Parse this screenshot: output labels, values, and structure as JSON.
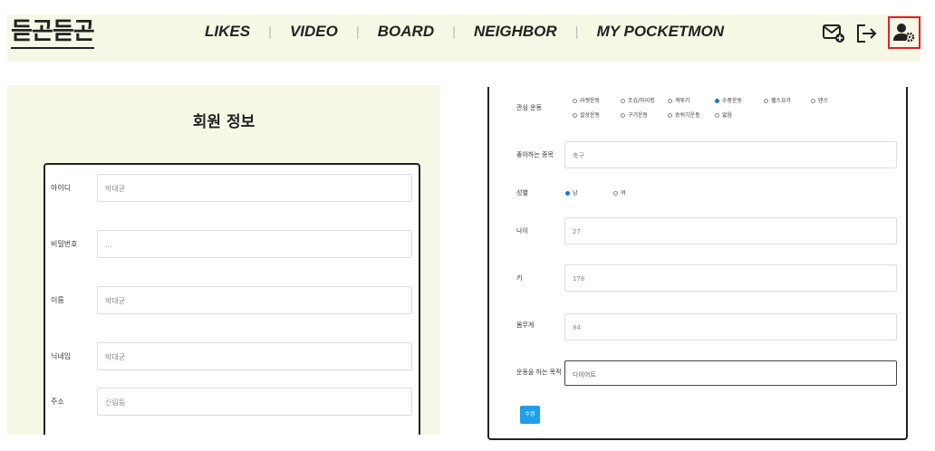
{
  "header": {
    "logo": "듣곤듣곤",
    "menu": [
      "LIKES",
      "VIDEO",
      "BOARD",
      "NEIGHBOR",
      "MY POCKETMON"
    ],
    "icons": [
      "mail-plus-icon",
      "logout-icon",
      "user-settings-icon"
    ]
  },
  "profile": {
    "title": "회원 정보",
    "fields": [
      {
        "label": "아이디",
        "value": "박대균"
      },
      {
        "label": "비밀번호",
        "value": "..."
      },
      {
        "label": "이름",
        "value": "박대균"
      },
      {
        "label": "닉네임",
        "value": "박대균"
      },
      {
        "label": "주소",
        "value": "신림동"
      }
    ]
  },
  "details": {
    "sports_label": "관심 운동",
    "sports_row1": [
      "라켓운동",
      "조깅/하이킹",
      "격투기",
      "수중운동",
      "헬스요가",
      "댄스"
    ],
    "sports_row2": [
      "설상운동",
      "구기운동",
      "승쉬기운동",
      "없음"
    ],
    "sports_selected": "수중운동",
    "favorite_label": "좋아하는 종목",
    "favorite_value": "축구",
    "gender_label": "성별",
    "gender_options": [
      "남",
      "여"
    ],
    "gender_selected": "남",
    "age_label": "나이",
    "age_value": "27",
    "height_label": "키",
    "height_value": "178",
    "weight_label": "몸무게",
    "weight_value": "84",
    "purpose_label": "운동을 하는 목적",
    "purpose_value": "다이어트",
    "submit_label": "수정"
  }
}
